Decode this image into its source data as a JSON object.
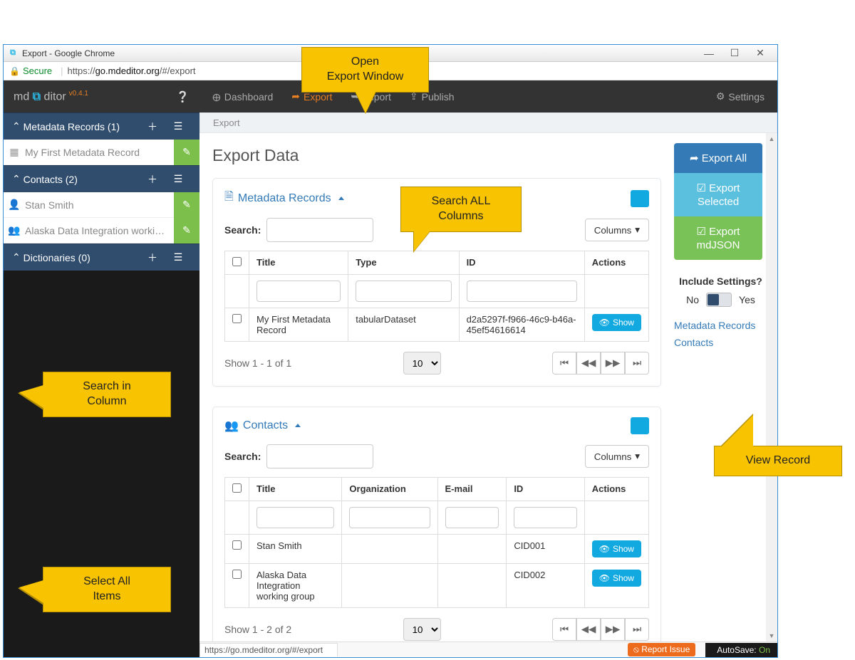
{
  "window": {
    "title": "Export - Google Chrome",
    "secure": "Secure",
    "url_prefix": "https://",
    "url_domain": "go.mdeditor.org",
    "url_path": "/#/export"
  },
  "brand": {
    "name": "md ",
    "editor": "ditor",
    "version": "v0.4.1"
  },
  "topnav": {
    "dashboard": "Dashboard",
    "export": "Export",
    "import": "Import",
    "publish": "Publish",
    "settings": "Settings"
  },
  "breadcrumb": "Export",
  "sidebar": {
    "metadata_label": "Metadata Records (1)",
    "contacts_label": "Contacts (2)",
    "dict_label": "Dictionaries (0)",
    "item_record": "My First Metadata Record",
    "item_contact1": "Stan Smith",
    "item_contact2": "Alaska Data Integration working…"
  },
  "page": {
    "title": "Export Data"
  },
  "panel_records": {
    "title": "Metadata Records",
    "search_label": "Search:",
    "columns_btn": "Columns",
    "th_title": "Title",
    "th_type": "Type",
    "th_id": "ID",
    "th_actions": "Actions",
    "row1_title": "My First Metadata Record",
    "row1_type": "tabularDataset",
    "row1_id": "d2a5297f-f966-46c9-b46a-45ef54616614",
    "show_btn": "Show",
    "pager_info": "Show 1 - 1 of 1",
    "page_size": "10"
  },
  "panel_contacts": {
    "title": "Contacts",
    "search_label": "Search:",
    "columns_btn": "Columns",
    "th_title": "Title",
    "th_org": "Organization",
    "th_email": "E-mail",
    "th_id": "ID",
    "th_actions": "Actions",
    "row1_title": "Stan Smith",
    "row1_id": "CID001",
    "row2_title": "Alaska Data Integration working group",
    "row2_id": "CID002",
    "show_btn": "Show",
    "pager_info": "Show 1 - 2 of 2",
    "page_size": "10"
  },
  "export": {
    "all": "Export All",
    "selected_l1": "Export",
    "selected_l2": "Selected",
    "json_l1": "Export",
    "json_l2": "mdJSON",
    "include": "Include Settings?",
    "no": "No",
    "yes": "Yes"
  },
  "links": {
    "records": "Metadata Records",
    "contacts": "Contacts"
  },
  "status": {
    "url": "https://go.mdeditor.org/#/export",
    "report": "Report Issue",
    "autosave_label": "AutoSave:",
    "autosave_state": "On"
  },
  "callouts": {
    "open_export": "Open\nExport Window",
    "search_all": "Search ALL\nColumns",
    "search_col": "Search in\nColumn",
    "select_all": "Select All\nItems",
    "view_record": "View Record"
  }
}
